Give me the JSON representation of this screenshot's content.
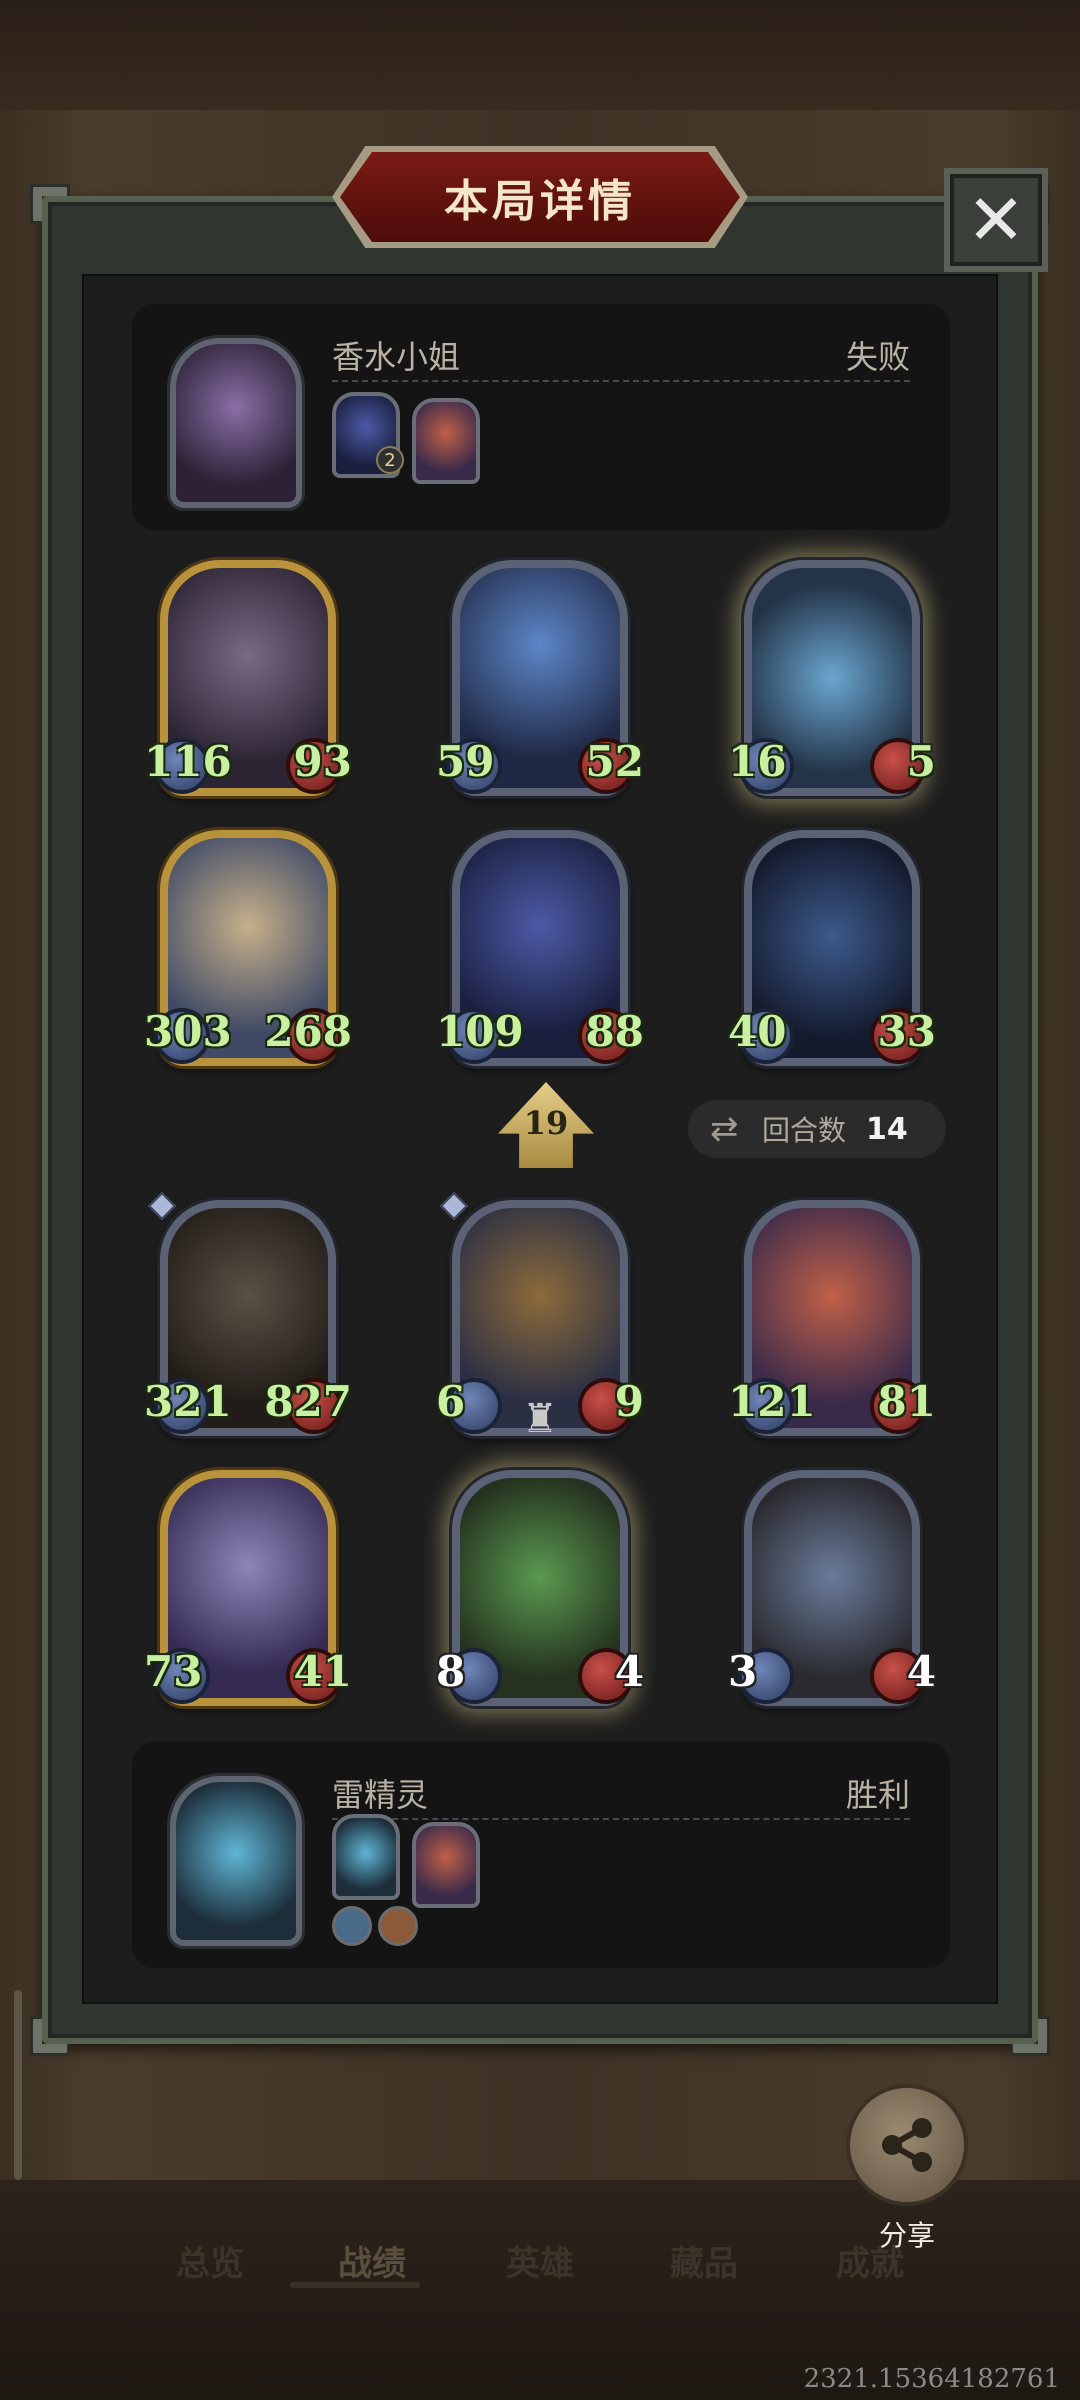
{
  "title": "本局详情",
  "close_label": "✕",
  "top_player": {
    "name": "香水小姐",
    "result": "失败",
    "badge": "2"
  },
  "bottom_player": {
    "name": "雷精灵",
    "result": "胜利"
  },
  "round": {
    "label": "回合数",
    "value": "14"
  },
  "tier": "19",
  "minions": [
    {
      "attack": "116",
      "health": "93"
    },
    {
      "attack": "59",
      "health": "52"
    },
    {
      "attack": "16",
      "health": "5"
    },
    {
      "attack": "303",
      "health": "268"
    },
    {
      "attack": "109",
      "health": "88"
    },
    {
      "attack": "40",
      "health": "33"
    },
    {
      "attack": "321",
      "health": "827"
    },
    {
      "attack": "6",
      "health": "9"
    },
    {
      "attack": "121",
      "health": "81"
    },
    {
      "attack": "73",
      "health": "41"
    },
    {
      "attack": "8",
      "health": "4"
    },
    {
      "attack": "3",
      "health": "4"
    }
  ],
  "share_label": "分享",
  "nav": [
    "总览",
    "战绩",
    "英雄",
    "藏品",
    "成就"
  ],
  "watermark": "2321.15364182761",
  "colors": {
    "frame": "#56614f",
    "stat_green": "#c8f0a0",
    "title_red": "#7a1a14",
    "gold_border": "#b8933c"
  }
}
